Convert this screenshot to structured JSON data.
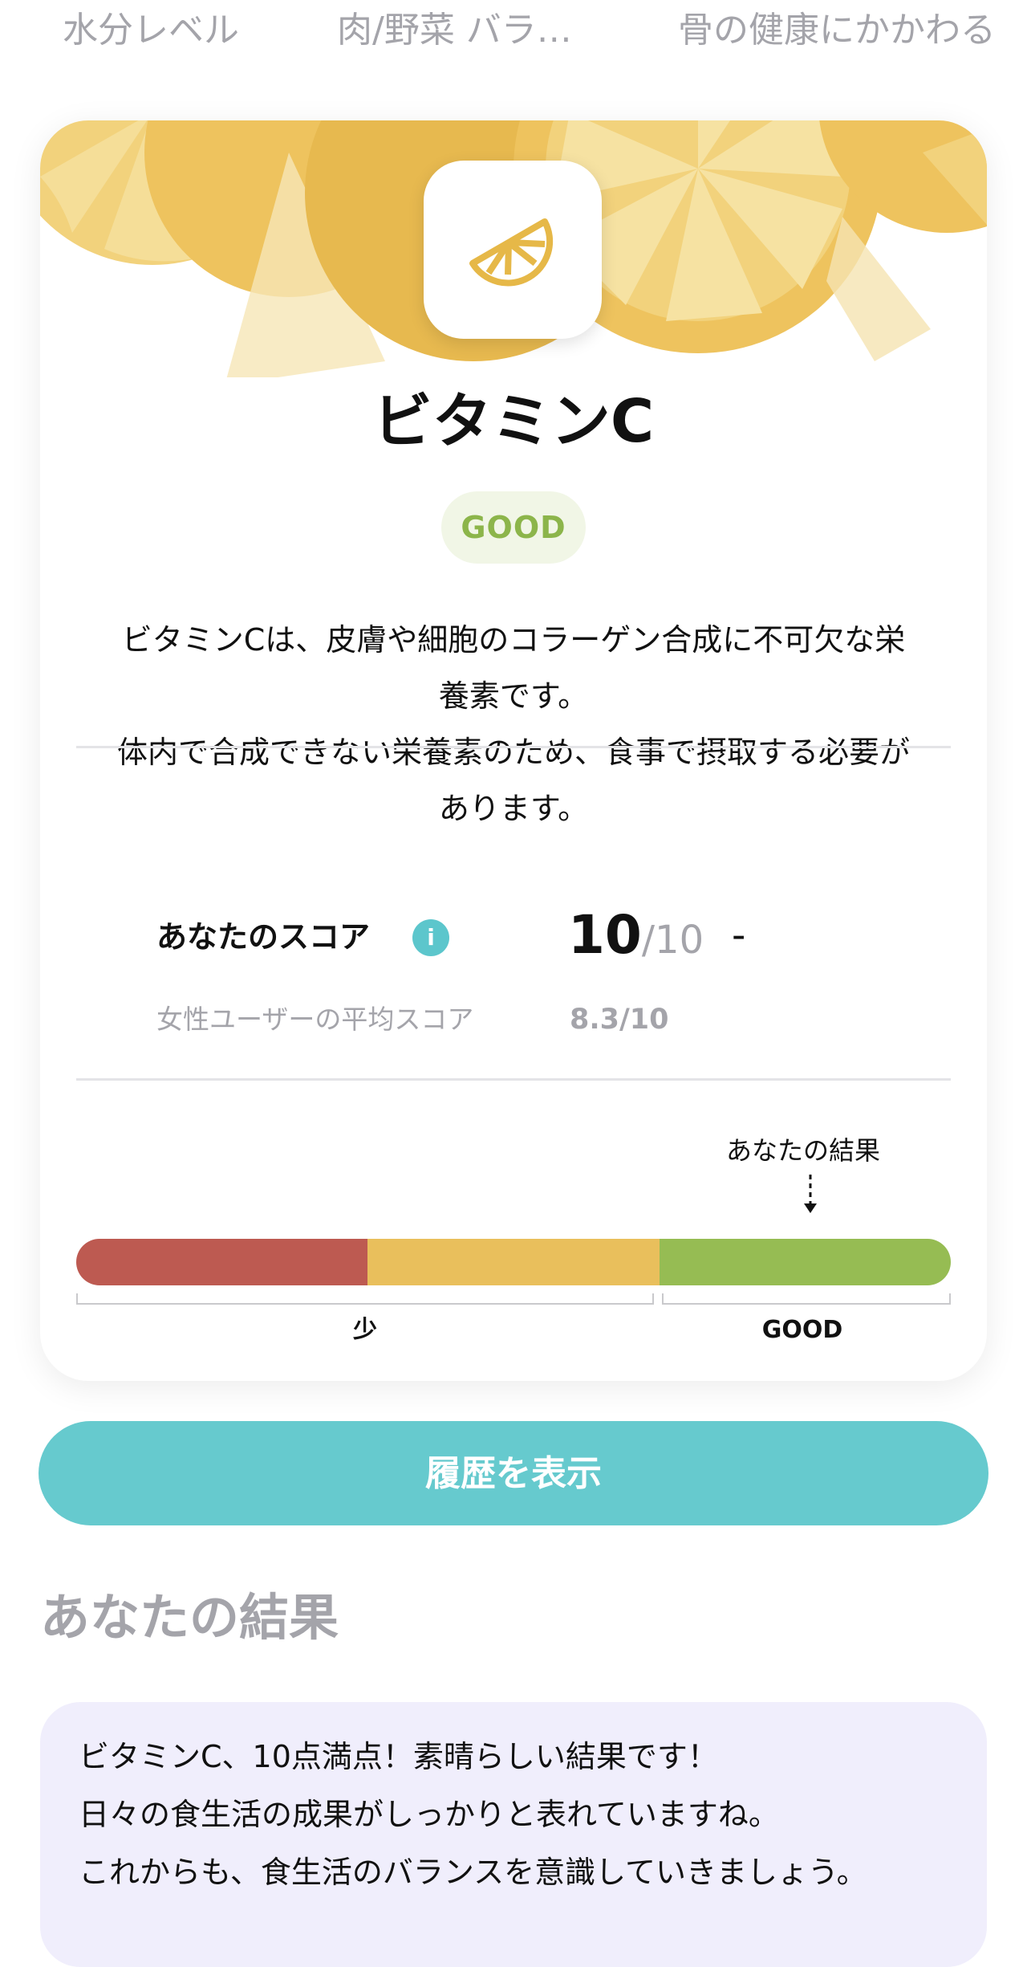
{
  "tabs": [
    {
      "label": "水分レベル"
    },
    {
      "label": "肉/野菜 バラ…"
    },
    {
      "label": "骨の健康にかかわる"
    }
  ],
  "card": {
    "title": "ビタミンC",
    "status": "GOOD",
    "description_lines": [
      "ビタミンCは、皮膚や細胞のコラーゲン合成に不可欠な栄",
      "養素です。",
      "体内で合成できない栄養素のため、食事で摂取する必要が",
      "あります。"
    ],
    "score": {
      "label": "あなたのスコア",
      "info_icon": "i",
      "value": "10",
      "max": "/10",
      "change": "-"
    },
    "average": {
      "label": "女性ユーザーの平均スコア",
      "value": "8.3/10"
    },
    "gauge": {
      "pointer_label": "あなたの結果",
      "segments": [
        {
          "color": "#bd5a51"
        },
        {
          "color": "#e9bf5c"
        },
        {
          "color": "#96bc53"
        }
      ],
      "labels": {
        "low": "少",
        "good": "GOOD"
      }
    }
  },
  "history_button": "履歴を表示",
  "results": {
    "section_title": "あなたの結果",
    "lines": [
      "ビタミンC、10点満点！素晴らしい結果です！",
      "日々の食生活の成果がしっかりと表れていますね。",
      "これからも、食生活のバランスを意識していきましょう。"
    ]
  },
  "colors": {
    "accent": "#66cace",
    "good": "#8cb54a",
    "lemon": "#e9bf5c"
  },
  "icons": {
    "hero": "lemon-slice-icon",
    "info": "info-icon",
    "pointer": "arrow-down-icon"
  }
}
